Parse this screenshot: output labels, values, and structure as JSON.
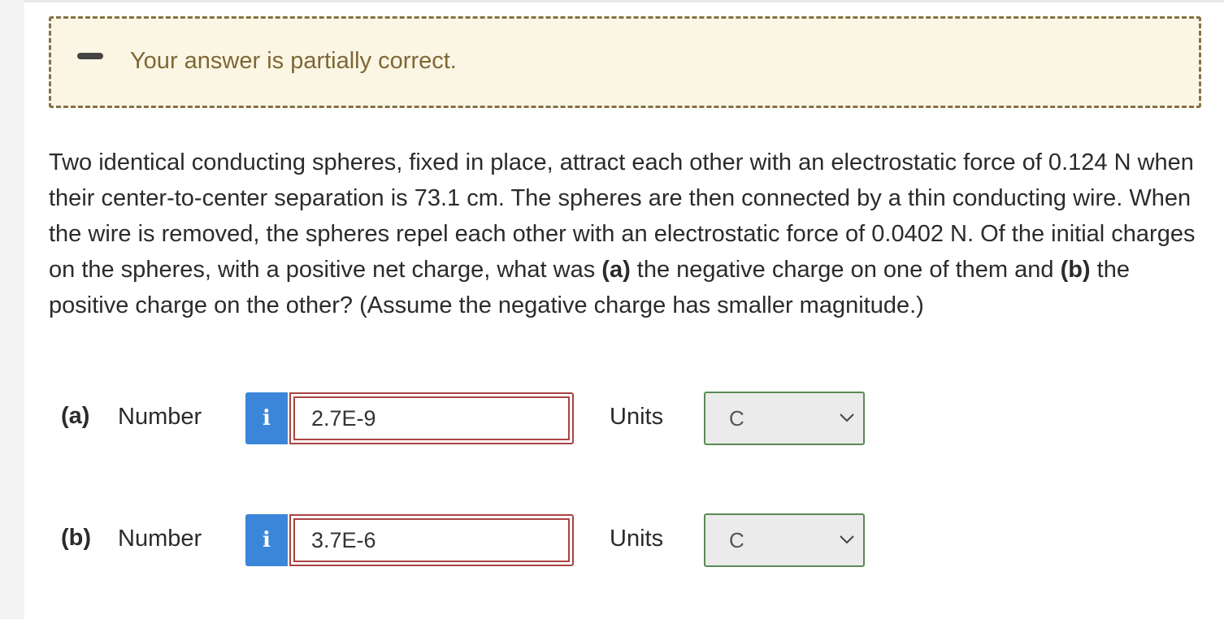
{
  "feedback": {
    "message": "Your answer is partially correct."
  },
  "question": {
    "text_1": "Two identical conducting spheres, fixed in place, attract each other with an electrostatic force of 0.124 N when their center-to-center separation is 73.1 cm. The spheres are then connected by a thin conducting wire. When the wire is removed, the spheres repel each other with an electrostatic force of 0.0402 N. Of the initial charges on the spheres, with a positive net charge, what was ",
    "part_a": "(a)",
    "text_2": " the negative charge on one of them and ",
    "part_b": "(b)",
    "text_3": " the positive charge on the other? (Assume the negative charge has smaller magnitude.)"
  },
  "answers": [
    {
      "part": "(a)",
      "number_label": "Number",
      "info_icon": "i",
      "value": "2.7E-9",
      "units_label": "Units",
      "unit": "C"
    },
    {
      "part": "(b)",
      "number_label": "Number",
      "info_icon": "i",
      "value": "3.7E-6",
      "units_label": "Units",
      "unit": "C"
    }
  ],
  "colors": {
    "feedback_background": "#fbf6e4",
    "feedback_border": "#857145",
    "feedback_text": "#7d6735",
    "info_button": "#3b86d8",
    "incorrect_border": "#a94442",
    "units_border": "#5a8a56"
  }
}
